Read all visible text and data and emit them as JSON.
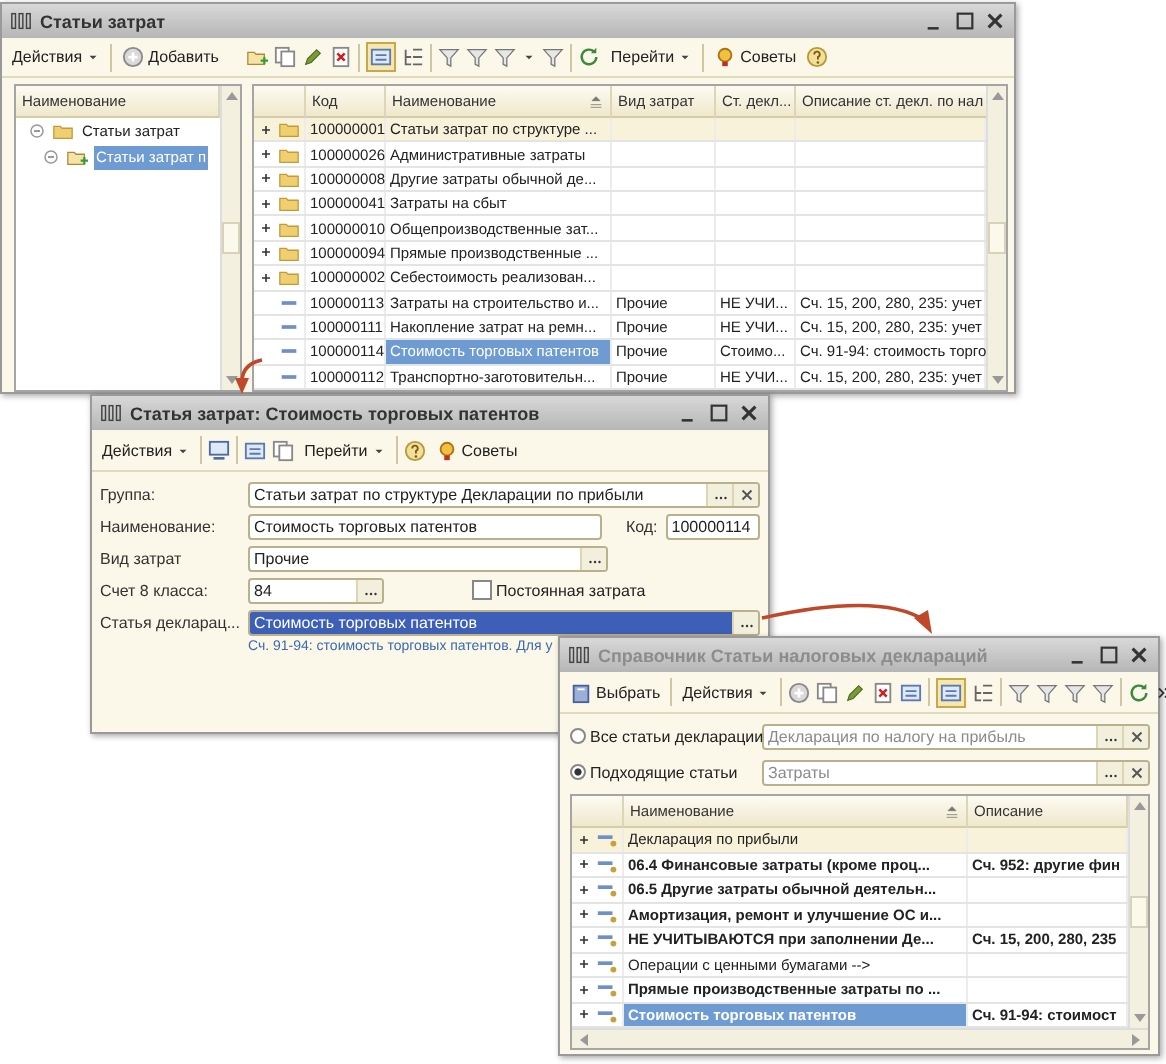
{
  "main_window": {
    "title": "Статьи затрат",
    "toolbar": [
      {
        "label": "Действия",
        "kind": "menu"
      },
      {
        "label": "Добавить",
        "kind": "button"
      },
      {
        "label": "Перейти",
        "kind": "menu"
      },
      {
        "label": "Советы",
        "kind": "button"
      }
    ],
    "tree": {
      "header": "Наименование",
      "items": [
        {
          "label": "Статьи затрат",
          "expanded": true,
          "selected": false,
          "children": [
            {
              "label": "Статьи затрат п",
              "expanded": true,
              "selected": true
            }
          ]
        }
      ]
    },
    "table": {
      "columns": [
        "Код",
        "Наименование",
        "Вид затрат",
        "Ст. декл...",
        "Описание ст. декл. по нал"
      ],
      "rows": [
        {
          "kind": "group",
          "code": "100000001",
          "name": "Статьи затрат по структуре ...",
          "highlighted": true,
          "selected": false
        },
        {
          "kind": "group",
          "code": "100000026",
          "name": "Административные затраты",
          "highlighted": false,
          "selected": false
        },
        {
          "kind": "group",
          "code": "100000008",
          "name": "Другие затраты обычной де...",
          "highlighted": false,
          "selected": false
        },
        {
          "kind": "group",
          "code": "100000041",
          "name": "Затраты на сбыт",
          "highlighted": false,
          "selected": false
        },
        {
          "kind": "group",
          "code": "100000010",
          "name": "Общепроизводственные зат...",
          "highlighted": false,
          "selected": false
        },
        {
          "kind": "group",
          "code": "100000094",
          "name": "Прямые производственные ...",
          "highlighted": false,
          "selected": false
        },
        {
          "kind": "group",
          "code": "100000002",
          "name": "Себестоимость реализован...",
          "highlighted": false,
          "selected": false
        },
        {
          "kind": "item",
          "code": "100000113",
          "name": "Затраты на строительство и...",
          "cost_type": "Прочие",
          "decl": "НЕ УЧИ...",
          "description": "Сч. 15, 200, 280, 235: учет",
          "highlighted": false,
          "selected": false
        },
        {
          "kind": "item",
          "code": "100000111",
          "name": "Накопление затрат на ремн...",
          "cost_type": "Прочие",
          "decl": "НЕ УЧИ...",
          "description": "Сч. 15, 200, 280, 235: учет",
          "highlighted": false,
          "selected": false
        },
        {
          "kind": "item",
          "code": "100000114",
          "name": "Стоимость торговых патентов",
          "cost_type": "Прочие",
          "decl": "Стоимо...",
          "description": "Сч. 91-94: стоимость торго",
          "highlighted": false,
          "selected": true
        },
        {
          "kind": "item",
          "code": "100000112",
          "name": "Транспортно-заготовительн...",
          "cost_type": "Прочие",
          "decl": "НЕ УЧИ...",
          "description": "Сч. 15, 200, 280, 235: учет",
          "highlighted": false,
          "selected": false
        }
      ]
    }
  },
  "form_window": {
    "title": "Статья затрат: Стоимость торговых патентов",
    "toolbar": [
      {
        "label": "Действия",
        "kind": "menu"
      },
      {
        "label": "Перейти",
        "kind": "menu"
      },
      {
        "label": "Советы",
        "kind": "button"
      }
    ],
    "group": {
      "label": "Группа:",
      "value": "Статьи затрат по структуре Декларации по прибыли"
    },
    "name": {
      "label": "Наименование:",
      "value": "Стоимость торговых патентов"
    },
    "code": {
      "label": "Код:",
      "value": "100000114"
    },
    "cost_type": {
      "label": "Вид затрат",
      "value": "Прочие"
    },
    "account": {
      "label": "Счет 8 класса:",
      "value": "84"
    },
    "constant": {
      "label": "Постоянная затрата",
      "checked": false
    },
    "declaration_item": {
      "label": "Статья декларац...",
      "value": "Стоимость торговых патентов",
      "selected": true
    },
    "hint": "Сч. 91-94: стоимость торговых патентов. Для у"
  },
  "picker_window": {
    "title": "Справочник Статьи налоговых деклараций",
    "toolbar": [
      {
        "label": "Выбрать",
        "kind": "button"
      },
      {
        "label": "Действия",
        "kind": "menu"
      }
    ],
    "filters": [
      {
        "label": "Все статьи декларации",
        "selected": false,
        "value": "Декларация по налогу на прибыль"
      },
      {
        "label": "Подходящие статьи",
        "selected": true,
        "value": "Затраты"
      }
    ],
    "table": {
      "columns": [
        "Наименование",
        "Описание"
      ],
      "rows": [
        {
          "name": "Декларация по прибыли",
          "bold": false,
          "highlighted": true,
          "selected": false
        },
        {
          "name": "06.4 Финансовые затраты (кроме проц...",
          "description": "Сч. 952: другие фин",
          "bold": true,
          "highlighted": false,
          "selected": false
        },
        {
          "name": "06.5 Другие затраты обычной деятельн...",
          "bold": true,
          "highlighted": false,
          "selected": false
        },
        {
          "name": "Амортизация, ремонт и улучшение ОС и...",
          "bold": true,
          "highlighted": false,
          "selected": false
        },
        {
          "name": "НЕ УЧИТЫВАЮТСЯ при заполнении Де...",
          "description": "Сч. 15, 200, 280, 235",
          "bold": true,
          "highlighted": false,
          "selected": false
        },
        {
          "name": "Операции с ценными бумагами -->",
          "bold": false,
          "highlighted": false,
          "selected": false
        },
        {
          "name": "Прямые производственные затраты по ...",
          "bold": true,
          "highlighted": false,
          "selected": false
        },
        {
          "name": "Стоимость торговых патентов",
          "description": "Сч. 91-94: стоимост",
          "bold": true,
          "highlighted": false,
          "selected": true
        }
      ]
    }
  }
}
